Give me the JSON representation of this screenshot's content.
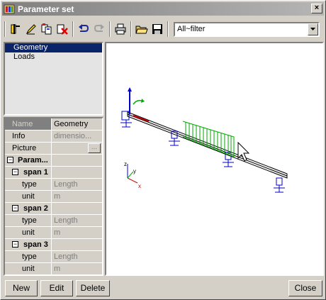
{
  "window": {
    "title": "Parameter set"
  },
  "toolbar": {
    "icons": [
      "new-parameter-icon",
      "edit-icon",
      "copy-icon",
      "delete-icon",
      "undo-icon",
      "redo-icon",
      "print-icon",
      "open-icon",
      "save-icon"
    ],
    "filter_value": "All~filter"
  },
  "list": {
    "items": [
      "Geometry",
      "Loads"
    ]
  },
  "properties": {
    "name_label": "Name",
    "name_value": "Geometry",
    "info_label": "Info",
    "info_value": "dimensio...",
    "picture_label": "Picture",
    "picture_button": "...",
    "params_label": "Param...",
    "spans": [
      {
        "label": "span 1",
        "type_label": "type",
        "type_value": "Length",
        "unit_label": "unit",
        "unit_value": "m"
      },
      {
        "label": "span 2",
        "type_label": "type",
        "type_value": "Length",
        "unit_label": "unit",
        "unit_value": "m"
      },
      {
        "label": "span 3",
        "type_label": "type",
        "type_value": "Length",
        "unit_label": "unit",
        "unit_value": "m"
      }
    ]
  },
  "view": {
    "axis_x": "x",
    "axis_y": "y",
    "axis_z": "z"
  },
  "buttons": {
    "new": "New",
    "edit": "Edit",
    "delete": "Delete",
    "close": "Close"
  },
  "colors": {
    "selection": "#0a246a",
    "load": "#00aa00",
    "support": "#0000cc",
    "beam": "#000000"
  }
}
